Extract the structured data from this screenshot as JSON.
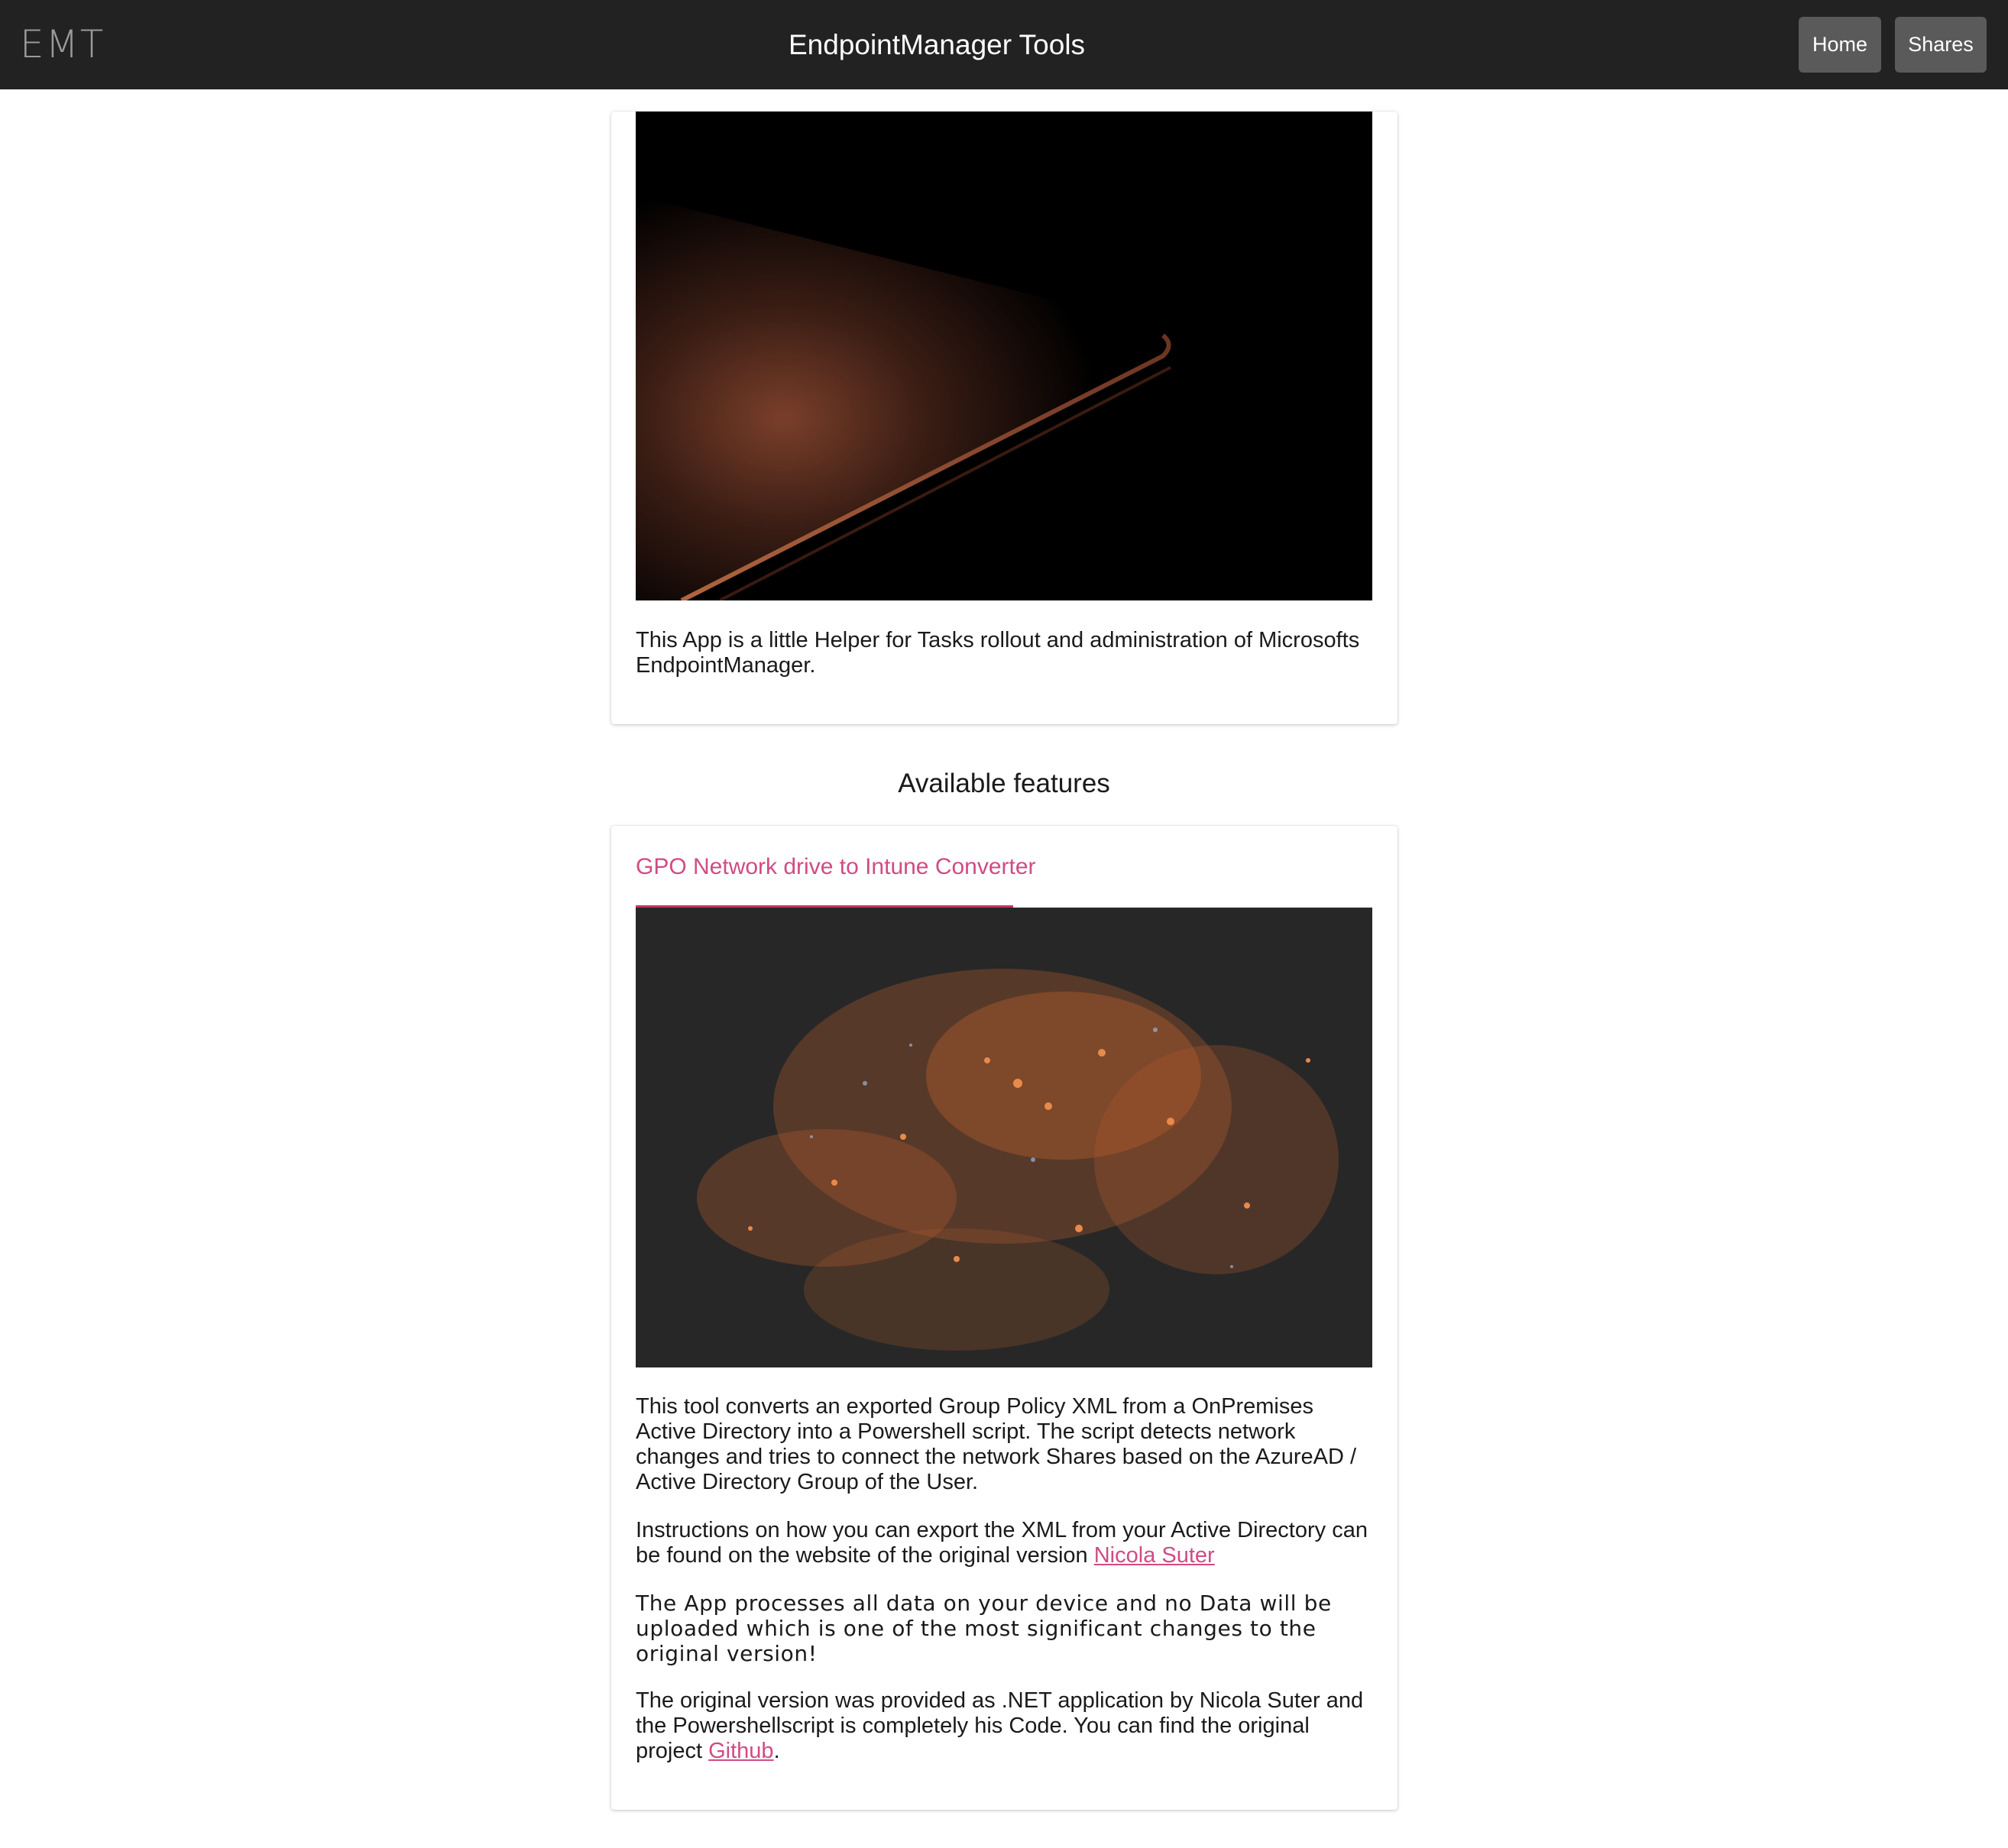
{
  "header": {
    "logo": "EMT",
    "title": "EndpointManager Tools",
    "nav": {
      "home": "Home",
      "shares": "Shares"
    }
  },
  "intro_card": {
    "image_icon": "laptop-edge-photo",
    "text": "This App is a little Helper for Tasks rollout and administration of Microsofts EndpointManager."
  },
  "features_heading": "Available features",
  "feature": {
    "title": "GPO Network drive to Intune Converter",
    "image_icon": "city-lights-night-photo",
    "p1": "This tool converts an exported Group Policy XML from a OnPremises Active Directory into a Powershell script. The script detects network changes and tries to connect the network Shares based on the AzureAD / Active Directory Group of the User.",
    "p2_text": "Instructions on how you can export the XML from your Active Directory can be found on the website of the original version ",
    "p2_link": "Nicola Suter",
    "p3": "The App processes all data on your device and no Data will be uploaded which is one of the most significant changes to the original version!",
    "p4_text": "The original version was provided as .NET application by Nicola Suter and the Powershellscript is completely his Code. You can find the original project ",
    "p4_link": "Github",
    "p4_end": "."
  },
  "colors": {
    "topbar": "#222222",
    "nav_button": "#5a5a5a",
    "accent": "#d14b84",
    "underline": "#c9306a"
  }
}
